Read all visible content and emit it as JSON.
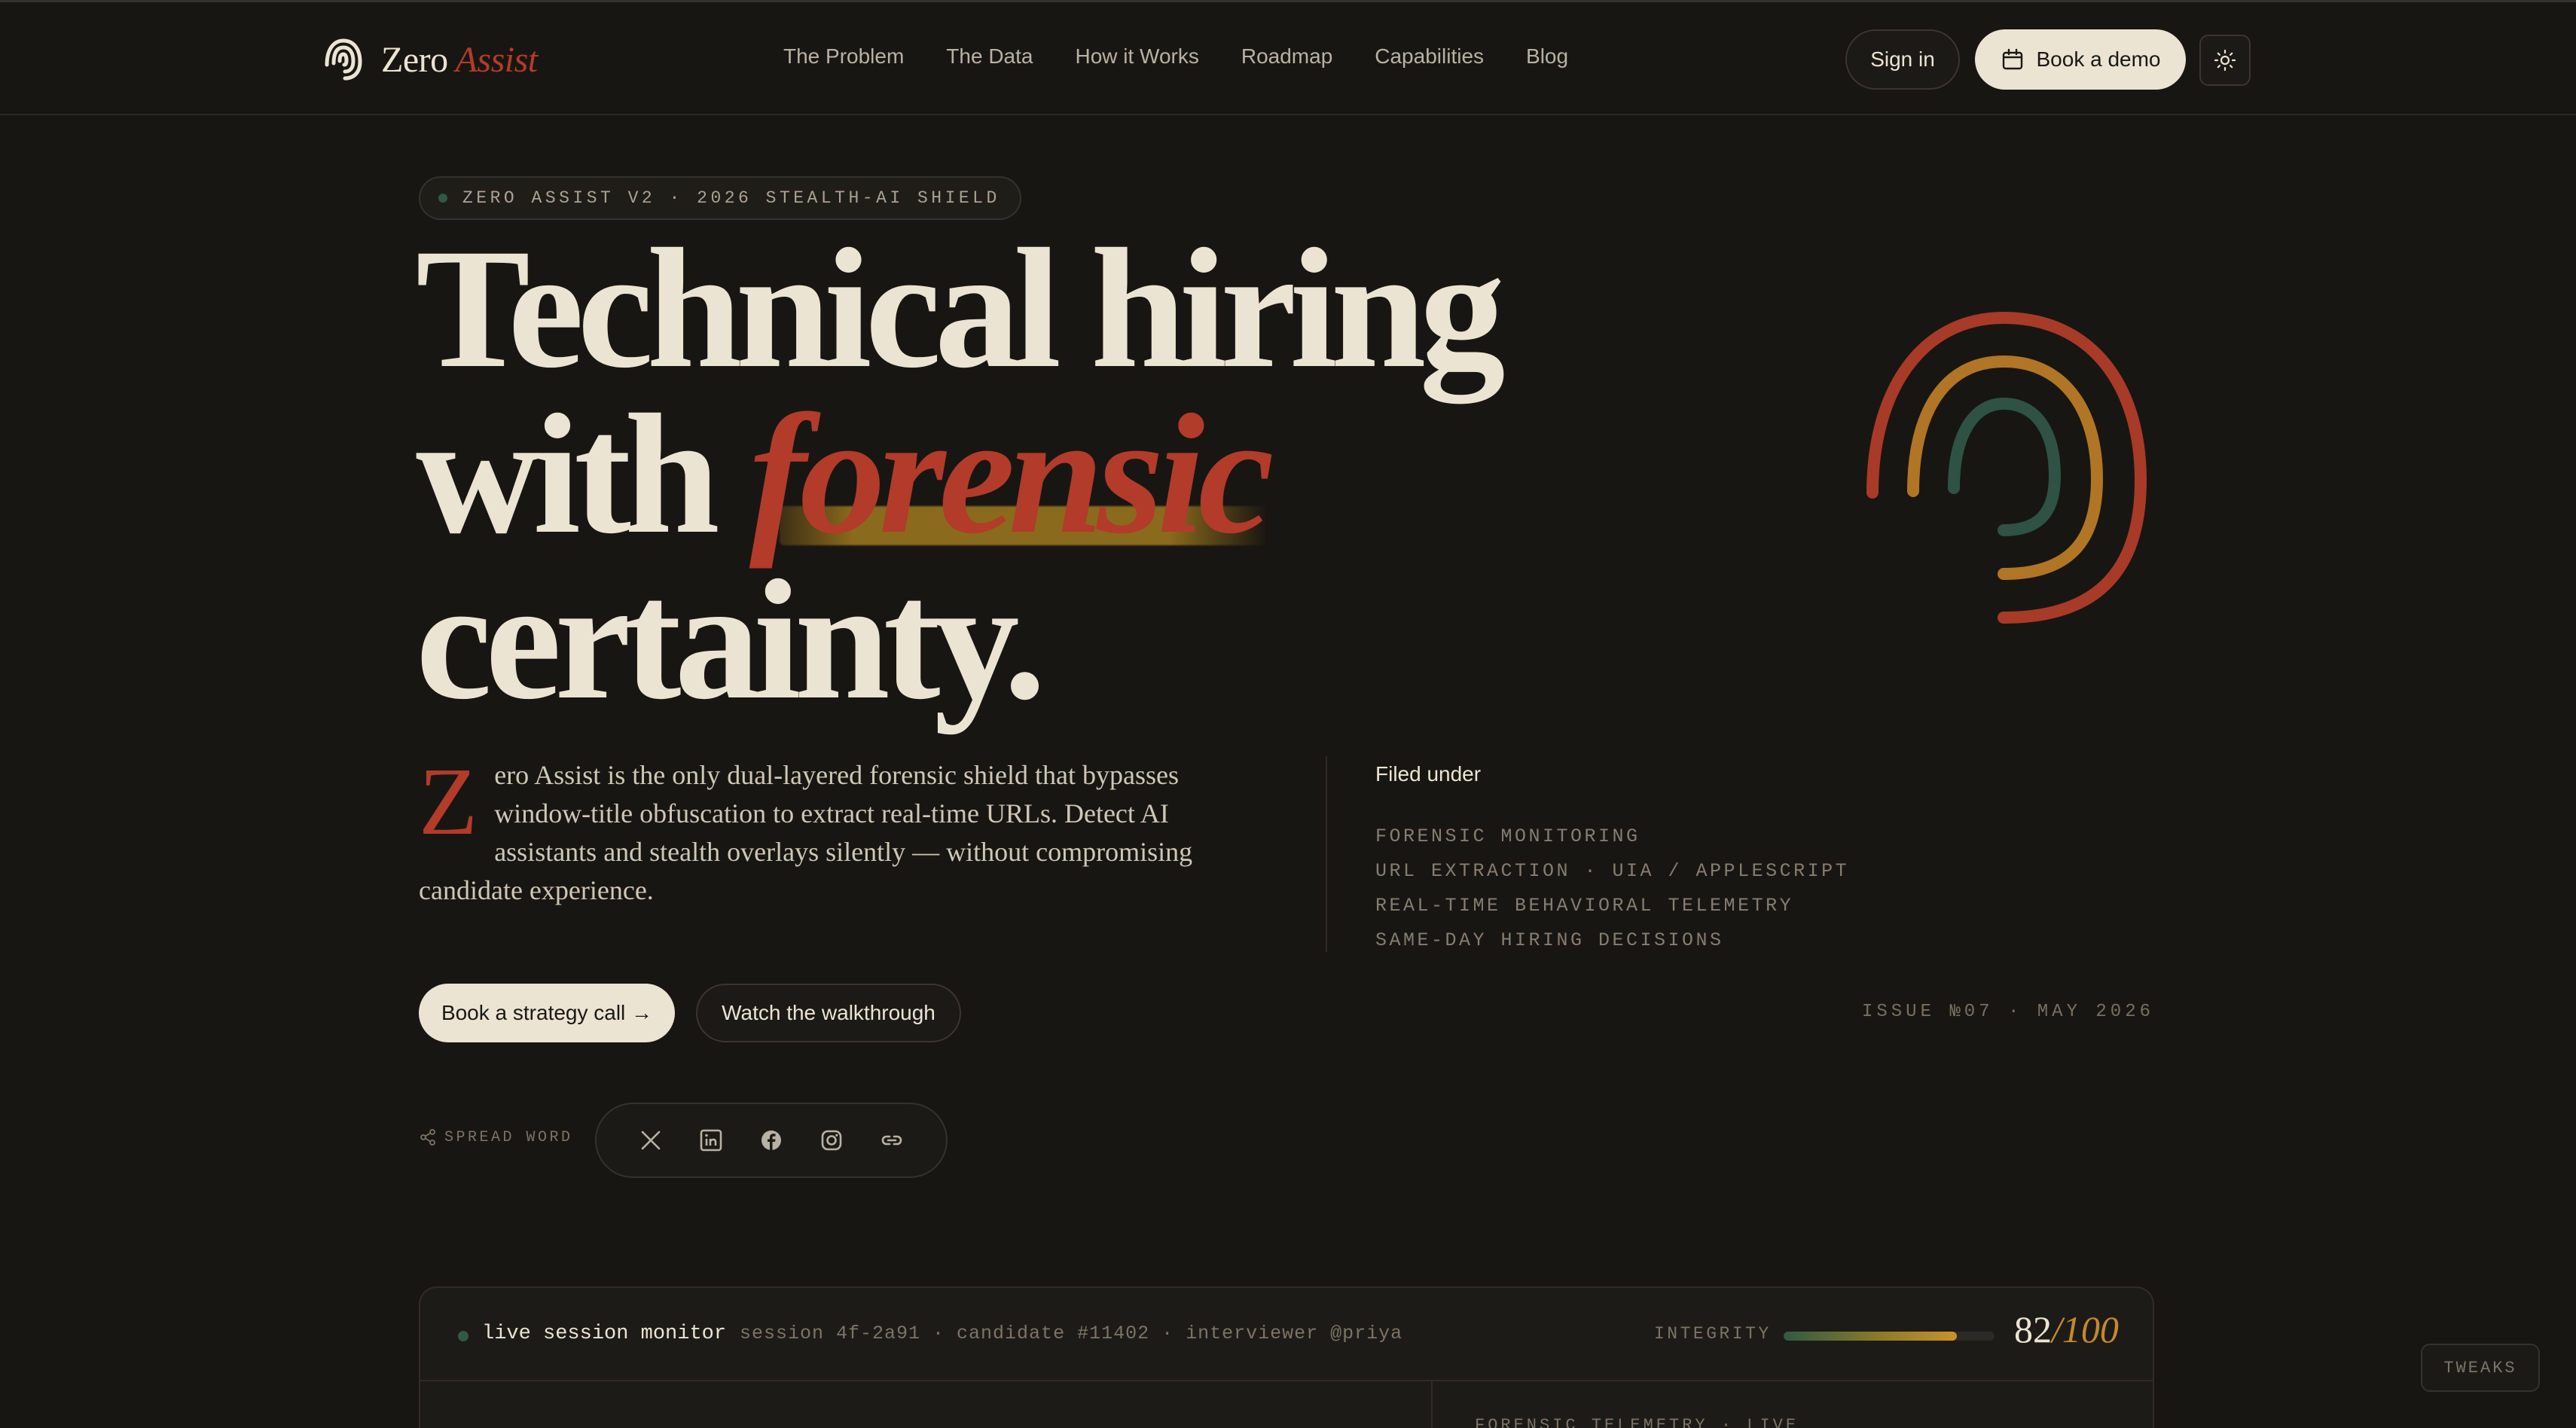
{
  "brand": {
    "name": "Zero",
    "accent": "Assist"
  },
  "nav": {
    "links": [
      "The Problem",
      "The Data",
      "How it Works",
      "Roadmap",
      "Capabilities",
      "Blog"
    ],
    "sign_in": "Sign in",
    "book_demo": "Book a demo",
    "theme_icon": "sun-icon"
  },
  "hero": {
    "pill": "ZERO ASSIST V2 · 2026 STEALTH-AI SHIELD",
    "headline_line1": "Technical hiring",
    "headline_with": "with",
    "headline_accent": "forensic",
    "headline_line3": "certainty.",
    "dropcap": "Z",
    "lede": "ero Assist is the only dual-layered forensic shield that bypasses window-title obfuscation to extract real-time URLs. Detect AI assistants and stealth overlays silently — without compromising candidate experience.",
    "filed_title": "Filed under",
    "filed_items": [
      "FORENSIC MONITORING",
      "URL EXTRACTION · UIA / APPLESCRIPT",
      "REAL-TIME BEHAVIORAL TELEMETRY",
      "SAME-DAY HIRING DECISIONS"
    ],
    "issue": "ISSUE №07 · MAY 2026",
    "cta_primary": "Book a strategy call →",
    "cta_secondary": "Watch the walkthrough",
    "spread_label": "SPREAD WORD",
    "social_icons": [
      "x-icon",
      "linkedin-icon",
      "facebook-icon",
      "instagram-icon",
      "link-icon"
    ]
  },
  "monitor": {
    "title": "live session monitor",
    "meta": "session 4f-2a91 · candidate #11402 · interviewer @priya",
    "integrity_label": "INTEGRITY",
    "integrity_value": 82,
    "score": "82",
    "score_den": "/100",
    "sub_label": "FORENSIC TELEMETRY · LIVE"
  },
  "tweaks": "TWEAKS",
  "colors": {
    "background": "#181612",
    "accent_red": "#b23b2a",
    "accent_gold": "#c48a2a",
    "accent_green": "#2f5a44",
    "cream": "#ece4d3"
  }
}
